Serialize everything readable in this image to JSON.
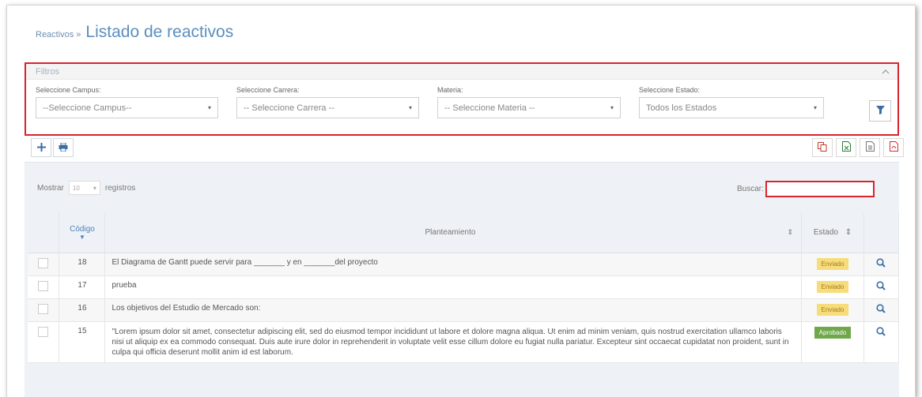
{
  "header": {
    "breadcrumb": "Reactivos",
    "separator": "»",
    "title": "Listado de reactivos"
  },
  "filters": {
    "title": "Filtros",
    "campus_label": "Seleccione Campus:",
    "campus_value": "--Seleccione Campus--",
    "carrera_label": "Seleccione Carrera:",
    "carrera_value": "-- Seleccione Carrera --",
    "materia_label": "Materia:",
    "materia_value": "-- Seleccione Materia --",
    "estado_label": "Seleccione Estado:",
    "estado_value": "Todos los Estados"
  },
  "table_controls": {
    "show_label": "Mostrar",
    "page_size": "10",
    "records_label": "registros",
    "search_label": "Buscar:"
  },
  "columns": {
    "code": "Código",
    "statement": "Planteamiento",
    "state": "Estado"
  },
  "rows": [
    {
      "code": "18",
      "statement": "El Diagrama de Gantt puede servir para _______ y en _______del proyecto",
      "state": "Enviado"
    },
    {
      "code": "17",
      "statement": "prueba",
      "state": "Enviado"
    },
    {
      "code": "16",
      "statement": "Los objetivos del Estudio de Mercado son:",
      "state": "Enviado"
    },
    {
      "code": "15",
      "statement": "\"Lorem ipsum dolor sit amet, consectetur adipiscing elit, sed do eiusmod tempor incididunt ut labore et dolore magna aliqua. Ut enim ad minim veniam, quis nostrud exercitation ullamco laboris nisi ut aliquip ex ea commodo consequat. Duis aute irure dolor in reprehenderit in voluptate velit esse cillum dolore eu fugiat nulla pariatur. Excepteur sint occaecat cupidatat non proident, sunt in culpa qui officia deserunt mollit anim id est laborum.",
      "state": "Aprobado"
    }
  ],
  "colors": {
    "accent": "#5b8fbf",
    "highlight": "#d9232d",
    "sent": "#f7dc7b",
    "approved": "#6ea84a"
  },
  "icons": [
    "plus-icon",
    "print-icon",
    "copy-icon",
    "excel-icon",
    "csv-icon",
    "pdf-icon",
    "filter-icon",
    "zoom-icon",
    "chevron-up-icon"
  ]
}
